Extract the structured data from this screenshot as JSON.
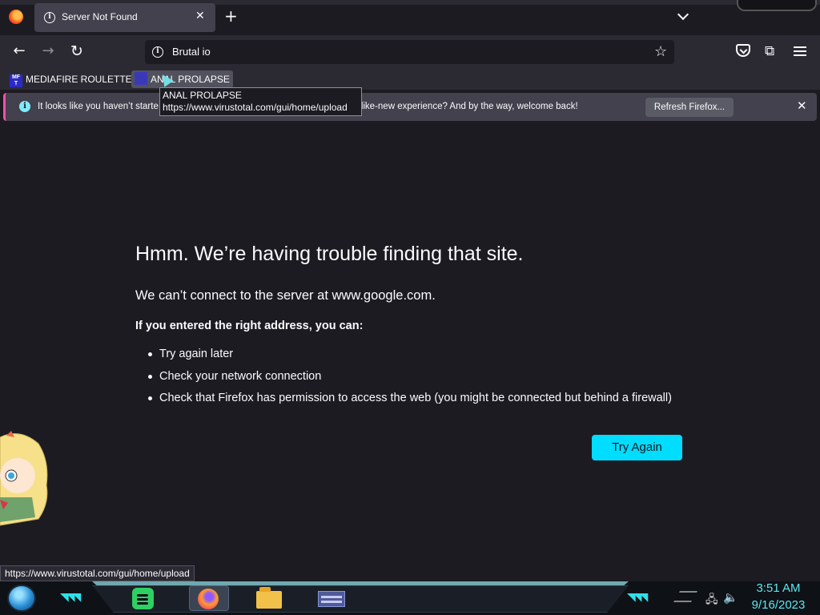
{
  "browser": {
    "tab": {
      "title": "Server Not Found"
    },
    "url": "Brutal io",
    "bookmarks": [
      {
        "label": "MEDIAFIRE ROULETTER",
        "favicon": "MF T"
      },
      {
        "label": "ANAL PROLAPSE"
      }
    ],
    "notification": {
      "message": "It looks like you haven’t starte… or a fresh, like-new experience? And by the way, welcome back!",
      "message_left": "It looks like you haven’t starte",
      "message_right": "or a fresh, like-new experience? And by the way, welcome back!",
      "button": "Refresh Firefox..."
    },
    "tooltip": {
      "title": "ANAL PROLAPSE",
      "url": "https://www.virustotal.com/gui/home/upload"
    },
    "status_link": "https://www.virustotal.com/gui/home/upload"
  },
  "error_page": {
    "title": "Hmm. We’re having trouble finding that site.",
    "description": "We can’t connect to the server at www.google.com.",
    "advice": "If you entered the right address, you can:",
    "items": [
      "Try again later",
      "Check your network connection",
      "Check that Firefox has permission to access the web (you might be connected but behind a firewall)"
    ],
    "button": "Try Again"
  },
  "taskbar": {
    "apps": [
      "spotify-icon",
      "firefox-icon",
      "file-explorer-icon",
      "window-icon"
    ],
    "clock": {
      "time": "3:51 AM",
      "date": "9/16/2023"
    }
  },
  "colors": {
    "accent": "#00ddff",
    "background": "#1c1b22",
    "toolbar": "#2b2a33",
    "clock": "#5be8ee"
  }
}
